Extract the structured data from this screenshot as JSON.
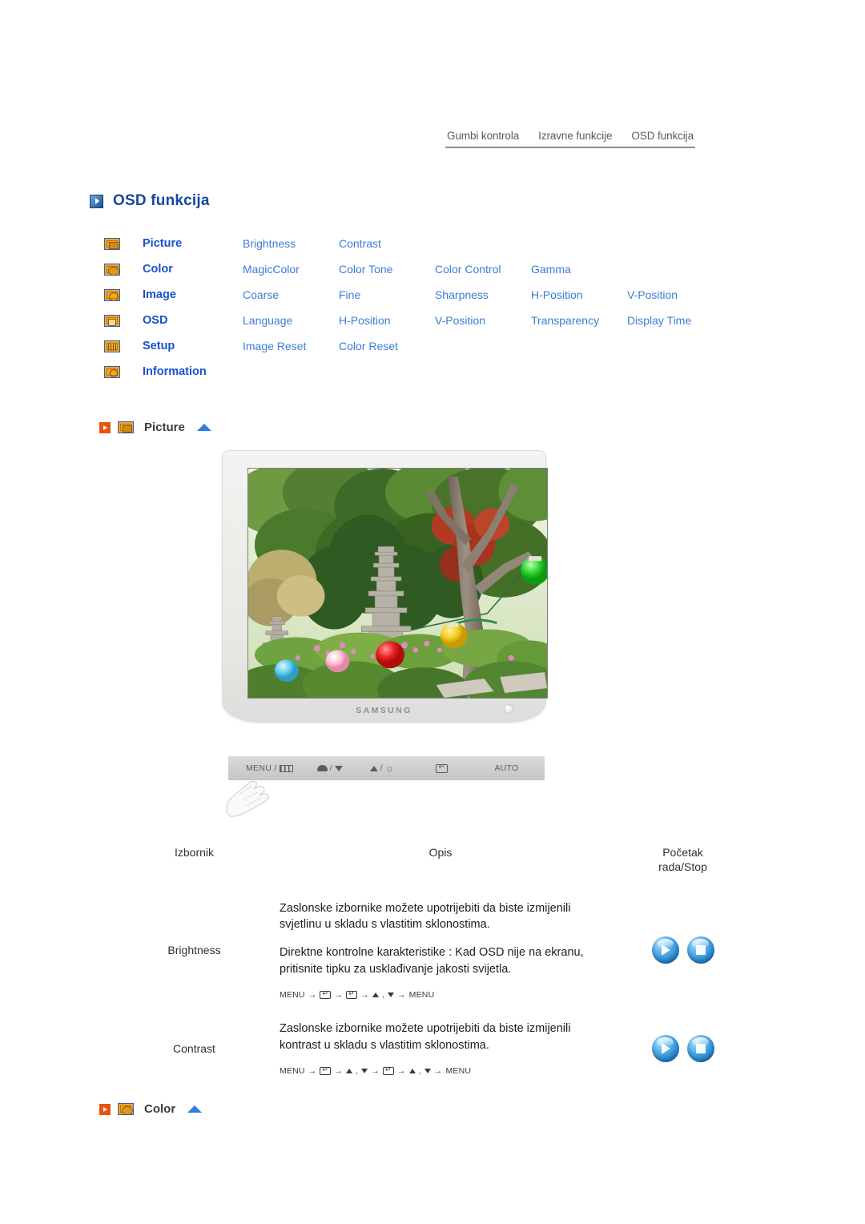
{
  "topnav": {
    "items": [
      "Gumbi kontrola",
      "Izravne funkcije",
      "OSD funkcija"
    ]
  },
  "page": {
    "title": "OSD funkcija"
  },
  "menu_matrix": [
    {
      "icon": "picture-icon",
      "main": "Picture",
      "subs": [
        "Brightness",
        "Contrast"
      ]
    },
    {
      "icon": "color-icon",
      "main": "Color",
      "subs": [
        "MagicColor",
        "Color Tone",
        "Color Control",
        "Gamma"
      ]
    },
    {
      "icon": "image-icon",
      "main": "Image",
      "subs": [
        "Coarse",
        "Fine",
        "Sharpness",
        "H-Position",
        "V-Position"
      ]
    },
    {
      "icon": "osd-icon",
      "main": "OSD",
      "subs": [
        "Language",
        "H-Position",
        "V-Position",
        "Transparency",
        "Display Time"
      ]
    },
    {
      "icon": "setup-icon",
      "main": "Setup",
      "subs": [
        "Image Reset",
        "Color Reset"
      ]
    },
    {
      "icon": "info-icon",
      "main": "Information",
      "subs": []
    }
  ],
  "sections": {
    "picture": {
      "label": "Picture"
    },
    "color": {
      "label": "Color"
    }
  },
  "monitor": {
    "brand": "SAMSUNG",
    "controls": [
      {
        "label": "MENU /",
        "glyph": "menu-bars-icon"
      },
      {
        "label": "/",
        "glyph": "cloud-down-icon"
      },
      {
        "label": "/",
        "glyph": "up-brightness-icon"
      },
      {
        "label": "",
        "glyph": "enter-icon"
      },
      {
        "label": "AUTO",
        "glyph": ""
      }
    ],
    "auto_label": "AUTO",
    "menu_label": "MENU /"
  },
  "table": {
    "headers": {
      "menu": "Izbornik",
      "description": "Opis",
      "control_line1": "Početak",
      "control_line2": "rada/Stop"
    },
    "rows": [
      {
        "menu": "Brightness",
        "paragraphs": [
          "Zaslonske izbornike možete upotrijebiti da biste izmijenili svjetlinu u skladu s vlastitim sklonostima.",
          "Direktne kontrolne karakteristike : Kad OSD nije na ekranu, pritisnite tipku za usklađivanje jakosti svijetla."
        ],
        "keyseq": [
          "MENU",
          "→",
          "ENTER",
          "→",
          "ENTER",
          "→",
          "UP",
          ",",
          "DOWN",
          "→",
          "MENU"
        ],
        "keyseq_text": "MENU → ↵ → ↵ → ▲ , ▼ → MENU"
      },
      {
        "menu": "Contrast",
        "paragraphs": [
          "Zaslonske izbornike možete upotrijebiti da biste izmijenili kontrast u skladu s vlastitim sklonostima."
        ],
        "keyseq": [
          "MENU",
          "→",
          "ENTER",
          "→",
          "UP",
          ",",
          "DOWN",
          "→",
          "ENTER",
          "→",
          "UP",
          ",",
          "DOWN",
          "→",
          "MENU"
        ],
        "keyseq_text": "MENU → ↵ → ▲ , ▼ → ↵ → ▲ , ▼ → MENU"
      }
    ]
  },
  "colors": {
    "title_blue": "#17479e",
    "menu_main_blue": "#1652cf",
    "menu_sub_blue": "#3b7dd8",
    "icon_orange": "#f5a623",
    "arrow_orange": "#e8540f",
    "up_arrow_blue": "#2d7fe0",
    "orb_blue": "#2f8ed6"
  }
}
